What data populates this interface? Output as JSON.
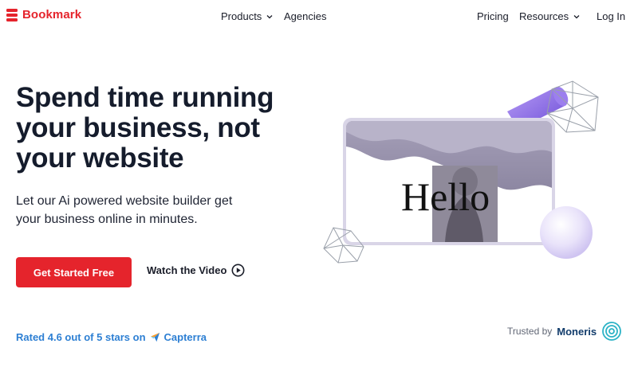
{
  "nav": {
    "brand": "Bookmark",
    "products": "Products",
    "agencies": "Agencies",
    "pricing": "Pricing",
    "resources": "Resources",
    "login": "Log In"
  },
  "hero": {
    "title": "Spend time running your business, not your website",
    "subtitle": "Let our Ai powered website builder get your business online in minutes.",
    "cta_label": "Get Started Free",
    "video_label": "Watch the Video",
    "illustration_text": "Hello"
  },
  "rating": {
    "text": "Rated 4.6 out of 5 stars on",
    "source": "Capterra"
  },
  "trust": {
    "label": "Trusted by",
    "partner": "Moneris"
  },
  "icons": [
    "bookmark-logo-icon",
    "chevron-down-icon",
    "play-icon",
    "capterra-icon",
    "moneris-icon"
  ],
  "colors": {
    "brand_red": "#e5242c",
    "text_dark": "#151c2c",
    "rating_blue": "#2d7fd3",
    "moneris_navy": "#123c6b",
    "frame_lavender": "#d6d2e6",
    "cylinder_purple": "#8a6fe0"
  }
}
